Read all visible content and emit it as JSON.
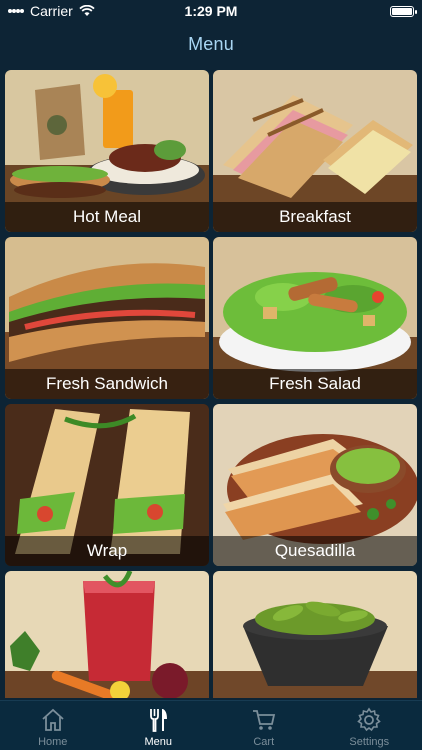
{
  "status": {
    "carrier": "Carrier",
    "time": "1:29 PM"
  },
  "nav": {
    "title": "Menu"
  },
  "menu": {
    "items": [
      {
        "label": "Hot Meal"
      },
      {
        "label": "Breakfast"
      },
      {
        "label": "Fresh Sandwich"
      },
      {
        "label": "Fresh Salad"
      },
      {
        "label": "Wrap"
      },
      {
        "label": "Quesadilla"
      },
      {
        "label": ""
      },
      {
        "label": ""
      }
    ]
  },
  "tabs": [
    {
      "label": "Home",
      "icon": "home-icon"
    },
    {
      "label": "Menu",
      "icon": "fork-knife-icon"
    },
    {
      "label": "Cart",
      "icon": "cart-icon"
    },
    {
      "label": "Settings",
      "icon": "gear-icon"
    }
  ],
  "colors": {
    "background": "#0d2435",
    "title": "#a9d6f3",
    "tab_active": "#ffffff",
    "tab_inactive": "#7b8e9a"
  }
}
